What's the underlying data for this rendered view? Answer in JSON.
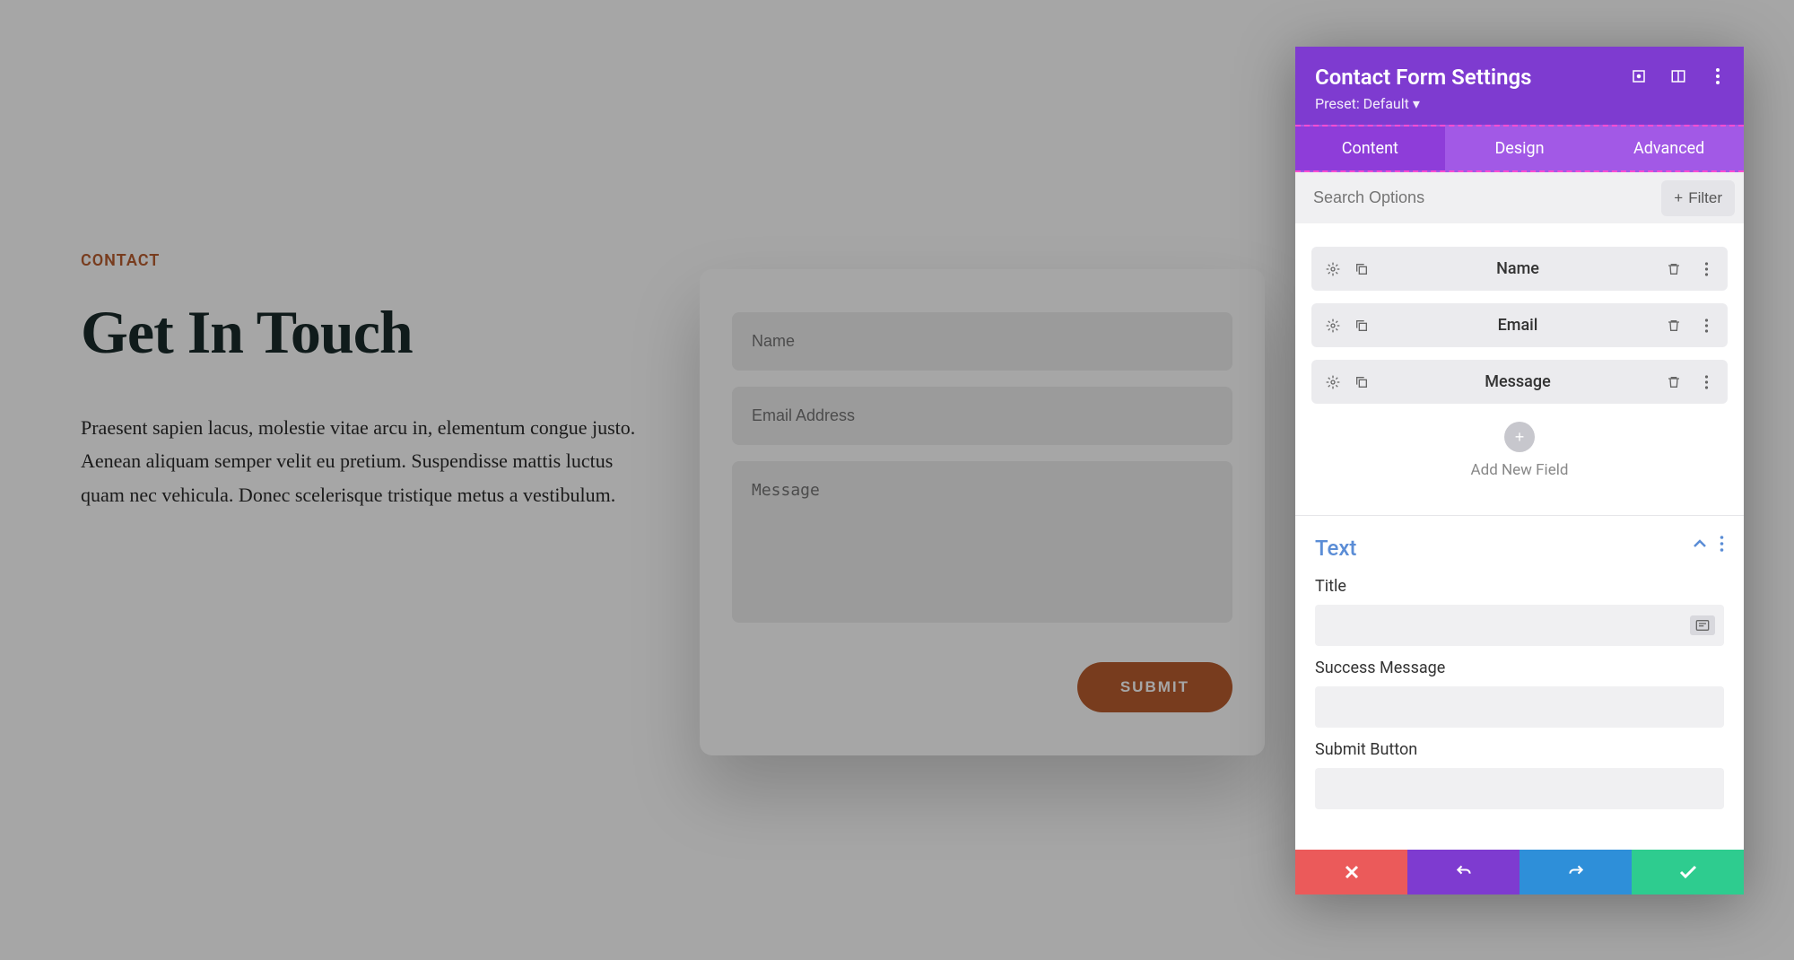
{
  "page": {
    "eyebrow": "CONTACT",
    "title": "Get In Touch",
    "description": "Praesent sapien lacus, molestie vitae arcu in, elementum congue justo. Aenean aliquam semper velit eu pretium. Suspendisse mattis luctus quam nec vehicula. Donec scelerisque tristique metus a vestibulum."
  },
  "form": {
    "name_placeholder": "Name",
    "email_placeholder": "Email Address",
    "message_placeholder": "Message",
    "submit_label": "SUBMIT"
  },
  "panel": {
    "title": "Contact Form Settings",
    "preset_label": "Preset: Default",
    "tabs": {
      "content": "Content",
      "design": "Design",
      "advanced": "Advanced"
    },
    "search_placeholder": "Search Options",
    "filter_label": "Filter",
    "fields": [
      {
        "label": "Name"
      },
      {
        "label": "Email"
      },
      {
        "label": "Message"
      }
    ],
    "add_field_label": "Add New Field",
    "text_section": {
      "heading": "Text",
      "title_label": "Title",
      "success_label": "Success Message",
      "submit_label": "Submit Button"
    }
  },
  "colors": {
    "accent_purple": "#7e3bd0",
    "accent_orange": "#b85c2e",
    "danger": "#eb5a5a",
    "info": "#2e8fd9",
    "success": "#2ecc8f"
  }
}
